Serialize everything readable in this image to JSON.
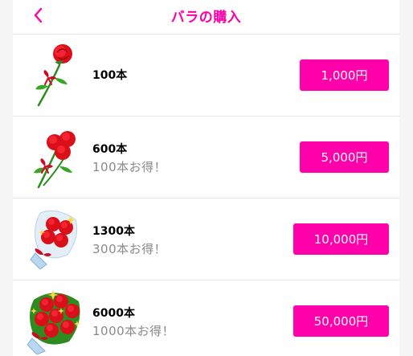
{
  "header": {
    "title": "バラの購入",
    "back_icon": "chevron-left-icon"
  },
  "colors": {
    "accent": "#ff00a8",
    "button": "#ff00ab",
    "bonus_text": "#8a8a8a",
    "divider": "#e6e6e6"
  },
  "items": [
    {
      "count": "100本",
      "bonus": "",
      "price": "1,000円",
      "icon": "single-rose-icon"
    },
    {
      "count": "600本",
      "bonus": "100本お得！",
      "price": "5,000円",
      "icon": "rose-trio-icon"
    },
    {
      "count": "1300本",
      "bonus": "300本お得！",
      "price": "10,000円",
      "icon": "rose-bouquet-icon"
    },
    {
      "count": "6000本",
      "bonus": "1000本お得！",
      "price": "50,000円",
      "icon": "large-rose-bouquet-icon"
    }
  ]
}
